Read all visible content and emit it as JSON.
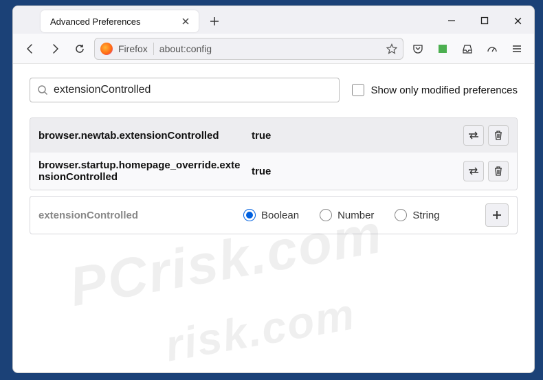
{
  "window": {
    "tab_title": "Advanced Preferences",
    "identity_label": "Firefox",
    "url": "about:config"
  },
  "search": {
    "value": "extensionControlled",
    "checkbox_label": "Show only modified preferences"
  },
  "prefs": [
    {
      "name": "browser.newtab.extensionControlled",
      "value": "true"
    },
    {
      "name": "browser.startup.homepage_override.extensionControlled",
      "value": "true"
    }
  ],
  "newpref": {
    "name": "extensionControlled",
    "options": [
      "Boolean",
      "Number",
      "String"
    ],
    "selected": "Boolean"
  },
  "watermark": {
    "line1": "PCrisk.com",
    "line2": "risk.com"
  }
}
